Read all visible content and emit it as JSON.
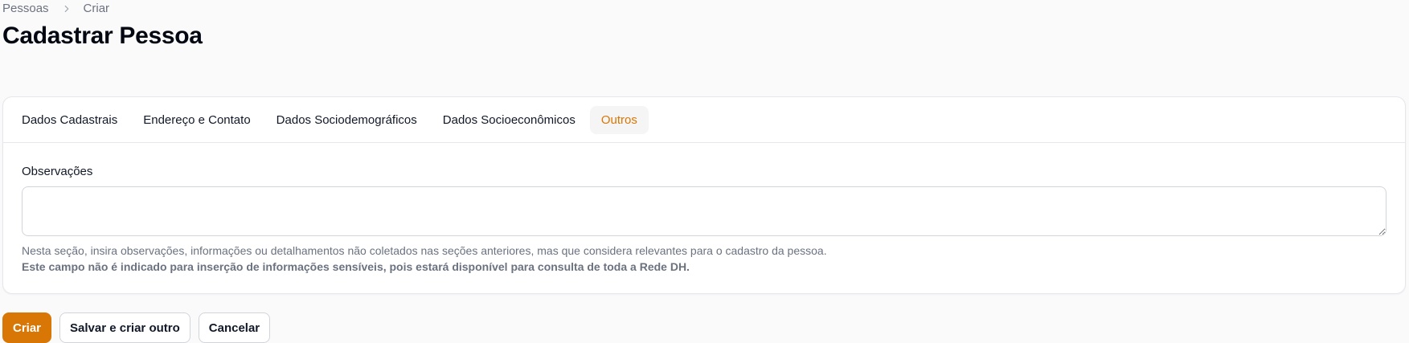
{
  "breadcrumb": {
    "items": [
      {
        "label": "Pessoas"
      },
      {
        "label": "Criar"
      }
    ]
  },
  "page": {
    "title": "Cadastrar Pessoa"
  },
  "tabs": [
    {
      "label": "Dados Cadastrais",
      "active": false
    },
    {
      "label": "Endereço e Contato",
      "active": false
    },
    {
      "label": "Dados Sociodemográficos",
      "active": false
    },
    {
      "label": "Dados Socioeconômicos",
      "active": false
    },
    {
      "label": "Outros",
      "active": true
    }
  ],
  "form": {
    "observacoes": {
      "label": "Observações",
      "value": "",
      "help_text": "Nesta seção, insira observações, informações ou detalhamentos não coletados nas seções anteriores, mas que considera relevantes para o cadastro da pessoa.",
      "help_warning": "Este campo não é indicado para inserção de informações sensíveis, pois estará disponível para consulta de toda a Rede DH."
    }
  },
  "actions": {
    "create_label": "Criar",
    "create_another_label": "Salvar e criar outro",
    "cancel_label": "Cancelar"
  },
  "colors": {
    "accent": "#d97706",
    "text": "#111827",
    "muted": "#6b7280",
    "border": "#e5e7eb"
  },
  "icons": {
    "breadcrumb_separator": "chevron-right-icon"
  }
}
